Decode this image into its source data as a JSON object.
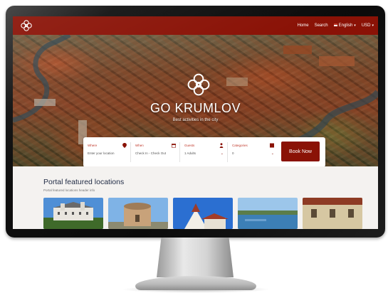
{
  "site": {
    "brand_color": "#8a1206"
  },
  "nav": {
    "links": [
      {
        "label": "Home"
      },
      {
        "label": "Search"
      }
    ],
    "language": "English",
    "currency": "USD"
  },
  "hero": {
    "title": "GO KRUMLOV",
    "subtitle": "Best activities in the city"
  },
  "search": {
    "fields": [
      {
        "label": "Where",
        "value": "Enter your location",
        "icon": "map-pin-icon"
      },
      {
        "label": "When",
        "value": "Check In - Check Out",
        "icon": "calendar-icon"
      },
      {
        "label": "Guests",
        "value": "1 Adults",
        "icon": "person-icon"
      },
      {
        "label": "Categories",
        "value": "0",
        "icon": "grid-icon"
      }
    ],
    "button_label": "Book Now"
  },
  "featured": {
    "title": "Portal featured locations",
    "subtitle": "Portal featured locations header info",
    "cards": [
      {
        "icon": "castle-photo"
      },
      {
        "icon": "tower-photo"
      },
      {
        "icon": "church-photo"
      },
      {
        "icon": "lake-photo"
      },
      {
        "icon": "building-photo"
      }
    ]
  }
}
